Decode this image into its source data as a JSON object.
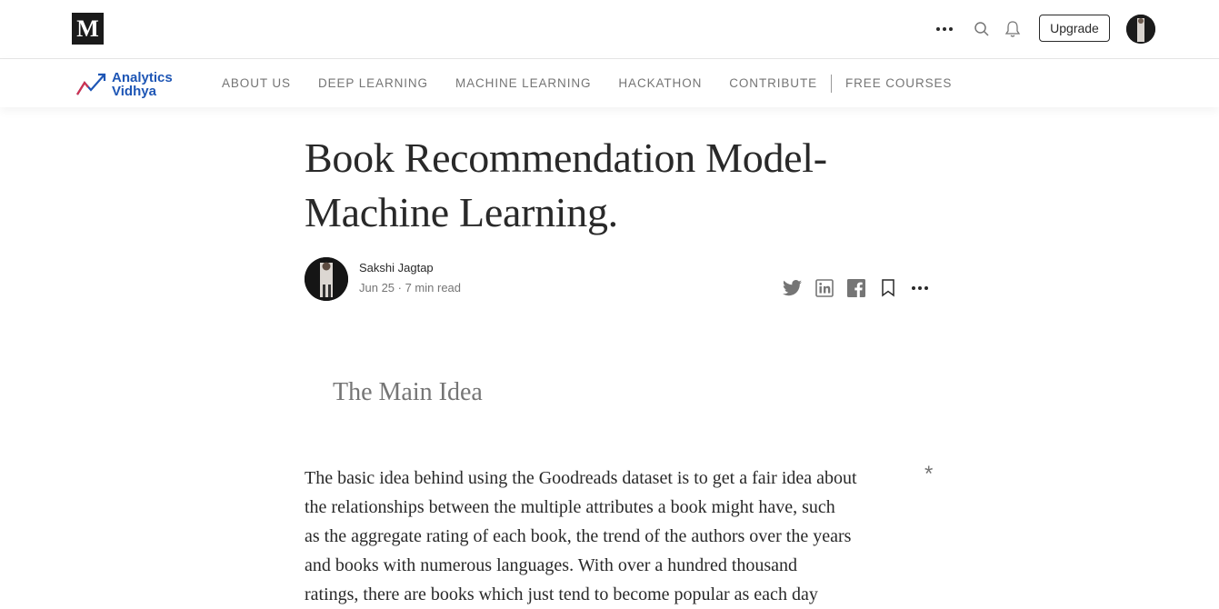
{
  "header": {
    "logo_letter": "M",
    "upgrade_label": "Upgrade"
  },
  "publication": {
    "name_line1": "Analytics",
    "name_line2": "Vidhya",
    "nav": [
      {
        "label": "ABOUT US"
      },
      {
        "label": "DEEP LEARNING"
      },
      {
        "label": "MACHINE LEARNING"
      },
      {
        "label": "HACKATHON"
      },
      {
        "label": "CONTRIBUTE"
      },
      {
        "label": "FREE COURSES"
      }
    ]
  },
  "article": {
    "title_line1": "Book Recommendation Model-",
    "title_line2": "Machine Learning.",
    "author": "Sakshi Jagtap",
    "meta": "Jun 25 · 7 min read",
    "subheading": "The Main Idea",
    "body_lines": [
      "The basic idea behind using the Goodreads dataset is to get a fair idea about",
      "the relationships between the multiple attributes a book might have, such",
      "as the aggregate rating of each book, the trend of the authors over the years",
      "and books with numerous languages. With over a hundred thousand",
      "ratings, there are books which just tend to become popular as each day"
    ],
    "note_marker": "*"
  },
  "colors": {
    "text": "#292929",
    "muted": "#757575",
    "brand": "#1e56b5"
  }
}
